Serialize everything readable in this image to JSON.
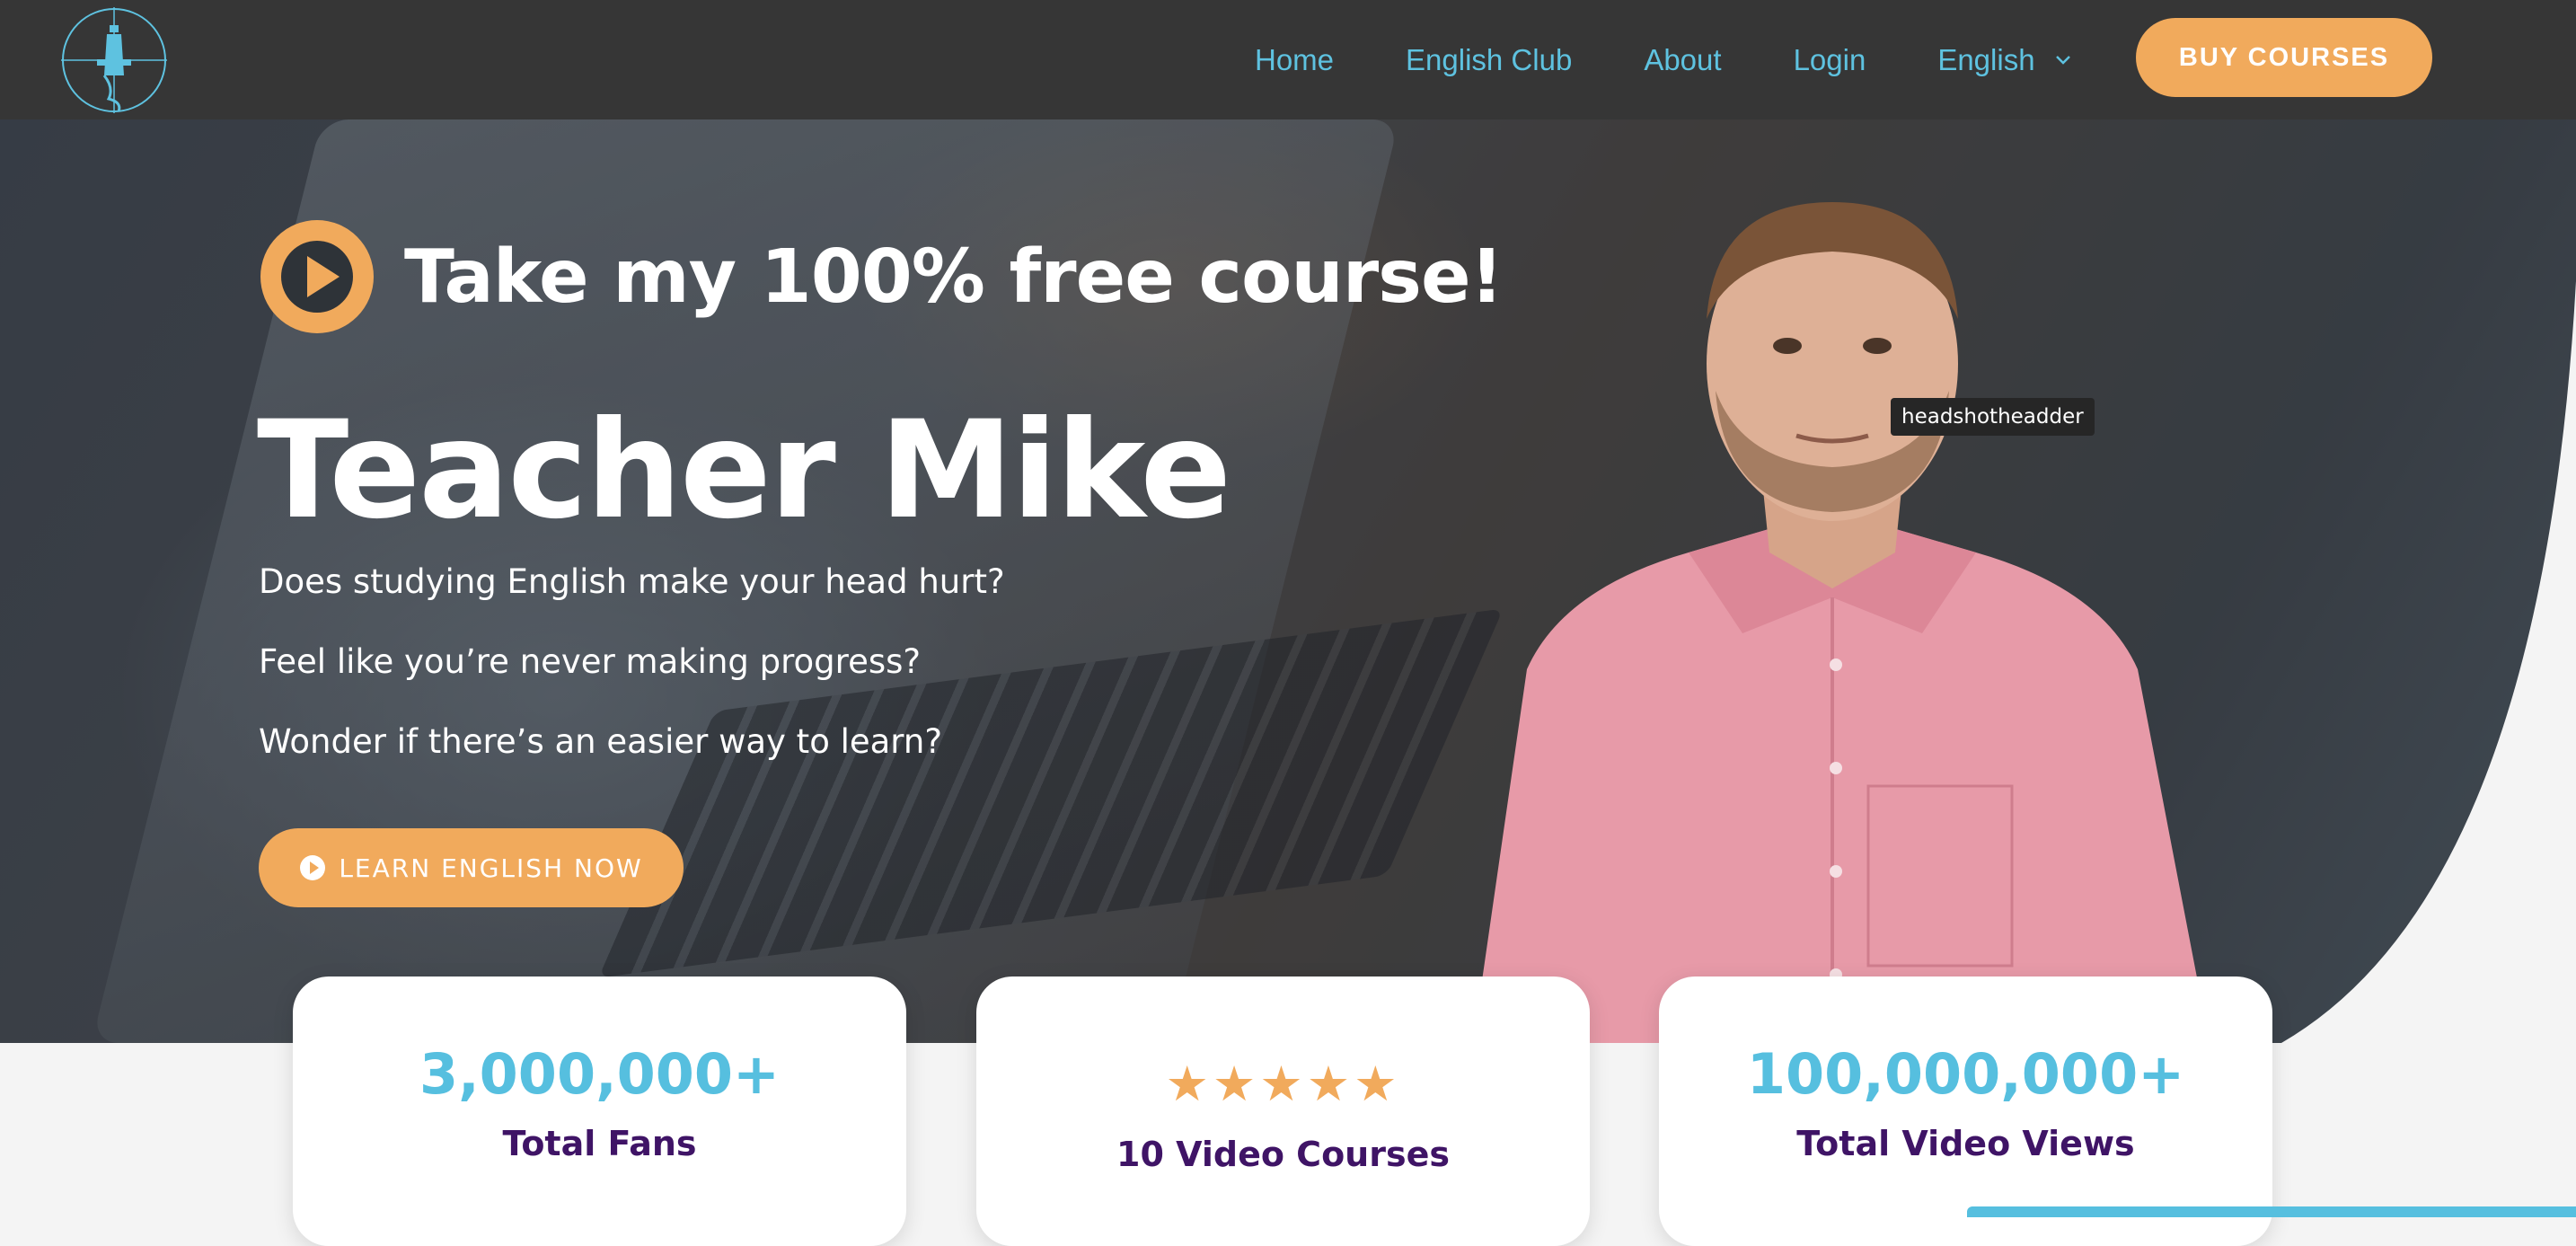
{
  "nav": {
    "logo_icon": "lighthouse-logo-icon",
    "links": [
      "Home",
      "English Club",
      "About",
      "Login"
    ],
    "language": "English",
    "buy_label": "BUY COURSES"
  },
  "hero": {
    "free_course": "Take my 100% free course!",
    "title": "Teacher Mike",
    "lines": [
      "Does studying English make your head hurt?",
      "Feel like you’re never making progress?",
      "Wonder if there’s an easier way to learn?"
    ],
    "cta_label": "LEARN ENGLISH NOW",
    "tooltip": "headshotheadder"
  },
  "stats": [
    {
      "value": "3,000,000+",
      "label": "Total Fans"
    },
    {
      "stars": "★★★★★",
      "label": "10 Video Courses"
    },
    {
      "value": "100,000,000+",
      "label": "Total Video Views"
    }
  ],
  "colors": {
    "nav_bg": "#363636",
    "accent_orange": "#f1aa5c",
    "accent_blue": "#56bfdf",
    "label_purple": "#3f1466"
  }
}
